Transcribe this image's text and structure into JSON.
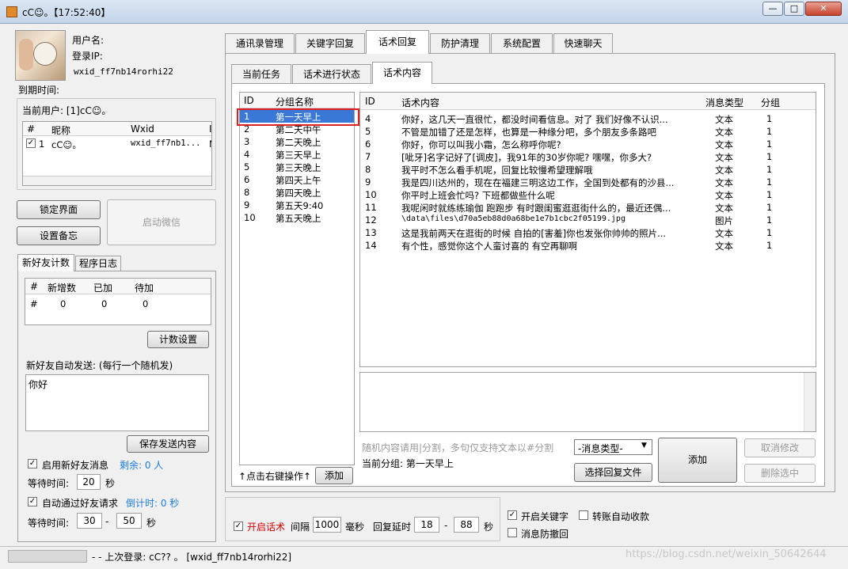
{
  "window": {
    "title": "cC☺。【17:52:40】",
    "minimize": "—",
    "maximize": "□",
    "close": "✕"
  },
  "profile": {
    "username_label": "用户名:",
    "login_ip_label": "登录IP:",
    "wxid": "wxid_ff7nb14rorhi22",
    "expire_label": "到期时间:",
    "current_user": "当前用户: [1]cC☺。"
  },
  "user_table": {
    "headers": [
      "#",
      "昵称",
      "Wxid",
      "I"
    ],
    "rows": [
      {
        "num": "1",
        "nick": "cC☺。",
        "wxid": "wxid_ff7nb1...",
        "extra": "M"
      }
    ]
  },
  "buttons": {
    "lock": "锁定界面",
    "backup": "设置备忘",
    "start_wechat": "启动微信",
    "count_settings": "计数设置",
    "save_send": "保存发送内容",
    "add_group": "添加",
    "add": "添加",
    "choose_file": "选择回复文件",
    "cancel_edit": "取消修改",
    "delete_selected": "删除选中"
  },
  "left_tabs": [
    "新好友计数",
    "程序日志"
  ],
  "count_table": {
    "headers": [
      "#",
      "新增数",
      "已加",
      "待加"
    ],
    "row": [
      "#",
      "0",
      "0",
      "0"
    ]
  },
  "auto_send": {
    "label": "新好友自动发送: (每行一个随机发)",
    "text": "你好"
  },
  "options": {
    "enable_new_friend": "启用新好友消息",
    "remaining": "剩余: 0 人",
    "wait_label": "等待时间:",
    "wait_value": "20",
    "sec": "秒",
    "auto_accept": "自动通过好友请求",
    "countdown": "倒计时: 0 秒",
    "wait_label2": "等待时间:",
    "wait_min": "30",
    "dash": "-",
    "wait_max": "50",
    "sec2": "秒"
  },
  "status_bar": {
    "text": "- - 上次登录: cC?? 。 [wxid_ff7nb14rorhi22]",
    "watermark": "https://blog.csdn.net/weixin_50642644"
  },
  "main_tabs": [
    "通讯录管理",
    "关键字回复",
    "话术回复",
    "防护清理",
    "系统配置",
    "快速聊天"
  ],
  "sub_tabs": [
    "当前任务",
    "话术进行状态",
    "话术内容"
  ],
  "group_table": {
    "headers": [
      "ID",
      "分组名称"
    ],
    "rows": [
      {
        "id": "1",
        "name": "第一天早上"
      },
      {
        "id": "2",
        "name": "第二天中午"
      },
      {
        "id": "3",
        "name": "第二天晚上"
      },
      {
        "id": "4",
        "name": "第三天早上"
      },
      {
        "id": "5",
        "name": "第三天晚上"
      },
      {
        "id": "6",
        "name": "第四天上午"
      },
      {
        "id": "8",
        "name": "第四天晚上"
      },
      {
        "id": "9",
        "name": "第五天9:40"
      },
      {
        "id": "10",
        "name": "第五天晚上"
      }
    ],
    "hint": "↑点击右键操作↑"
  },
  "content_table": {
    "headers": [
      "ID",
      "话术内容",
      "消息类型",
      "分组"
    ],
    "rows": [
      {
        "id": "4",
        "text": "你好，这几天一直很忙，都没时间看信息。对了 我们好像不认识...",
        "type": "文本",
        "group": "1"
      },
      {
        "id": "5",
        "text": "不管是加错了还是怎样，也算是一种缘分吧，多个朋友多条路吧",
        "type": "文本",
        "group": "1"
      },
      {
        "id": "6",
        "text": "你好，你可以叫我小霜，怎么称呼你呢?",
        "type": "文本",
        "group": "1"
      },
      {
        "id": "7",
        "text": "[呲牙]名字记好了[调皮]，我91年的30岁你呢? 嘿嘿，你多大?",
        "type": "文本",
        "group": "1"
      },
      {
        "id": "8",
        "text": "我平时不怎么看手机呢，回复比较慢希望理解哦",
        "type": "文本",
        "group": "1"
      },
      {
        "id": "9",
        "text": "我是四川达州的，现在在福建三明这边工作，全国到处都有的沙县...",
        "type": "文本",
        "group": "1"
      },
      {
        "id": "10",
        "text": "你平时上班会忙吗? 下班都做些什么呢",
        "type": "文本",
        "group": "1"
      },
      {
        "id": "11",
        "text": "我呢闲时就练练瑜伽 跑跑步 有时跟闺蜜逛逛街什么的，最近还偶...",
        "type": "文本",
        "group": "1"
      },
      {
        "id": "12",
        "text": "\\data\\files\\d70a5eb88d0a68be1e7b1cbc2f05199.jpg",
        "type": "图片",
        "group": "1"
      },
      {
        "id": "13",
        "text": "这是我前两天在逛街的时候 自拍的[害羞]你也发张你帅帅的照片...",
        "type": "文本",
        "group": "1"
      },
      {
        "id": "14",
        "text": "有个性，感觉你这个人蛮讨喜的 有空再聊啊",
        "type": "文本",
        "group": "1"
      }
    ]
  },
  "editor": {
    "hint": "随机内容请用|分割，多句仅支持文本以#分割",
    "current_group": "当前分组: 第一天早上",
    "msg_type_select": "-消息类型-"
  },
  "bottom_controls": {
    "enable_script": "开启话术",
    "interval": "间隔",
    "interval_value": "1000",
    "ms": "毫秒",
    "reply_delay": "回复延时",
    "delay_min": "18",
    "dash": "-",
    "delay_max": "88",
    "sec": "秒",
    "enable_keyword": "开启关键字",
    "auto_transfer": "转账自动收款",
    "anti_recall": "消息防撤回"
  }
}
